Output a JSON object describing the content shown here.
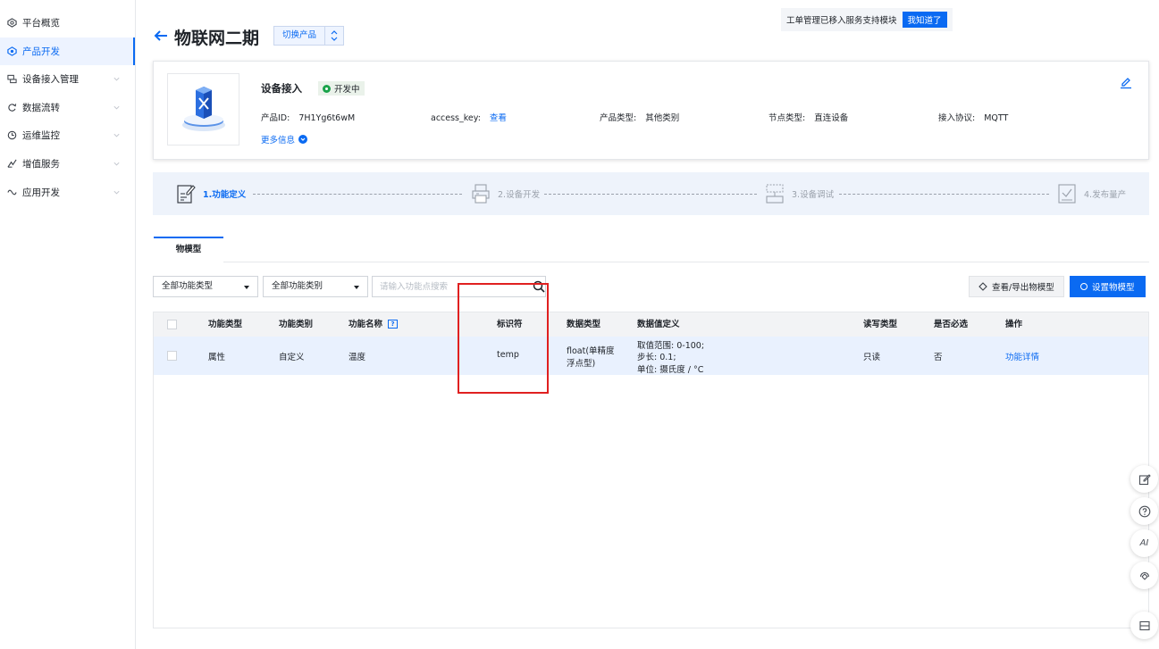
{
  "sidebar": {
    "items": [
      {
        "label": "平台概览",
        "icon": "overview-icon",
        "active": false,
        "expandable": false
      },
      {
        "label": "产品开发",
        "icon": "product-dev-icon",
        "active": true,
        "expandable": false
      },
      {
        "label": "设备接入管理",
        "icon": "device-access-icon",
        "active": false,
        "expandable": true
      },
      {
        "label": "数据流转",
        "icon": "data-flow-icon",
        "active": false,
        "expandable": true
      },
      {
        "label": "运维监控",
        "icon": "monitor-icon",
        "active": false,
        "expandable": true
      },
      {
        "label": "增值服务",
        "icon": "value-added-icon",
        "active": false,
        "expandable": true
      },
      {
        "label": "应用开发",
        "icon": "app-dev-icon",
        "active": false,
        "expandable": true
      }
    ]
  },
  "header": {
    "title": "物联网二期",
    "switch_label": "切换产品"
  },
  "notice": {
    "text": "工单管理已移入服务支持模块",
    "button": "我知道了"
  },
  "product": {
    "name": "设备接入",
    "status": "开发中",
    "fields": {
      "id_label": "产品ID:",
      "id_value": "7H1Yg6t6wM",
      "key_label": "access_key:",
      "key_link": "查看",
      "type_label": "产品类型:",
      "type_value": "其他类别",
      "node_label": "节点类型:",
      "node_value": "直连设备",
      "protocol_label": "接入协议:",
      "protocol_value": "MQTT"
    },
    "more_info": "更多信息"
  },
  "steps": [
    {
      "label": "1.功能定义",
      "state": "active"
    },
    {
      "label": "2.设备开发",
      "state": "inactive"
    },
    {
      "label": "3.设备调试",
      "state": "inactive"
    },
    {
      "label": "4.发布量产",
      "state": "inactive"
    }
  ],
  "tabs": [
    {
      "label": "物模型"
    }
  ],
  "filters": {
    "function_type": "全部功能类型",
    "function_category": "全部功能类别",
    "search_placeholder": "请输入功能点搜索"
  },
  "actions": {
    "view_export": "查看/导出物模型",
    "set_model": "设置物模型"
  },
  "table": {
    "headers": {
      "type": "功能类型",
      "category": "功能类别",
      "name": "功能名称",
      "identifier": "标识符",
      "data_type": "数据类型",
      "data_def": "数据值定义",
      "rw": "读写类型",
      "required": "是否必选",
      "ops": "操作"
    },
    "rows": [
      {
        "type": "属性",
        "category": "自定义",
        "name": "温度",
        "identifier": "temp",
        "data_type_line1": "float(单精度",
        "data_type_line2": "浮点型)",
        "def_line1": "取值范围: 0-100;",
        "def_line2": "步长: 0.1;",
        "def_line3": "单位: 摄氏度 / °C",
        "rw": "只读",
        "required": "否",
        "op": "功能详情"
      }
    ]
  },
  "tools": {
    "ai_label": "AI"
  },
  "colors": {
    "primary": "#0a6af2",
    "status_green": "#1aa34a",
    "highlight_red": "#e02020"
  }
}
